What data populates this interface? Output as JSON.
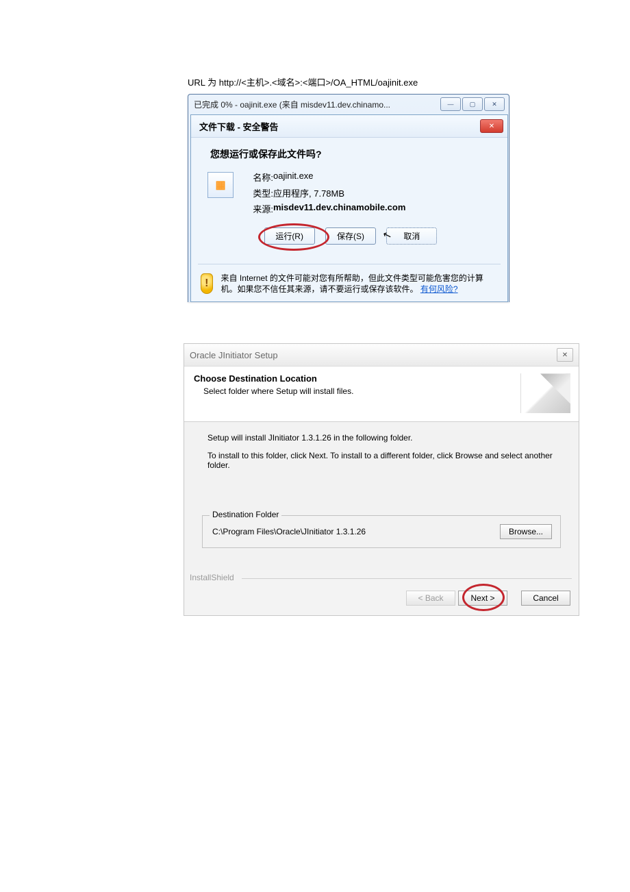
{
  "url_line": "URL 为 http://<主机>.<域名>:<端口>/OA_HTML/oajinit.exe",
  "dlprog": {
    "title": "已完成 0% - oajinit.exe (来自 misdev11.dev.chinamo..."
  },
  "sec": {
    "title": "文件下载 - 安全警告",
    "heading": "您想运行或保存此文件吗?",
    "labels": {
      "name": "名称:",
      "type": "类型:",
      "source": "来源:"
    },
    "values": {
      "name": "oajinit.exe",
      "type": "应用程序, 7.78MB",
      "source": "misdev11.dev.chinamobile.com"
    },
    "buttons": {
      "run": "运行(R)",
      "save": "保存(S)",
      "cancel": "取消"
    },
    "warning": "来自 Internet 的文件可能对您有所帮助，但此文件类型可能危害您的计算机。如果您不信任其来源，请不要运行或保存该软件。",
    "risk_link": "有何风险?"
  },
  "wizard": {
    "title": "Oracle JInitiator Setup",
    "h1": "Choose Destination Location",
    "h2": "Select folder where Setup will install files.",
    "line1": "Setup will install JInitiator 1.3.1.26 in the following folder.",
    "line2": "To install to this folder, click Next. To install to a different folder, click Browse and select another folder.",
    "dest_legend": "Destination Folder",
    "dest_path": "C:\\Program Files\\Oracle\\JInitiator 1.3.1.26",
    "browse": "Browse...",
    "brand": "InstallShield",
    "back": "< Back",
    "next": "Next >",
    "cancel": "Cancel"
  }
}
